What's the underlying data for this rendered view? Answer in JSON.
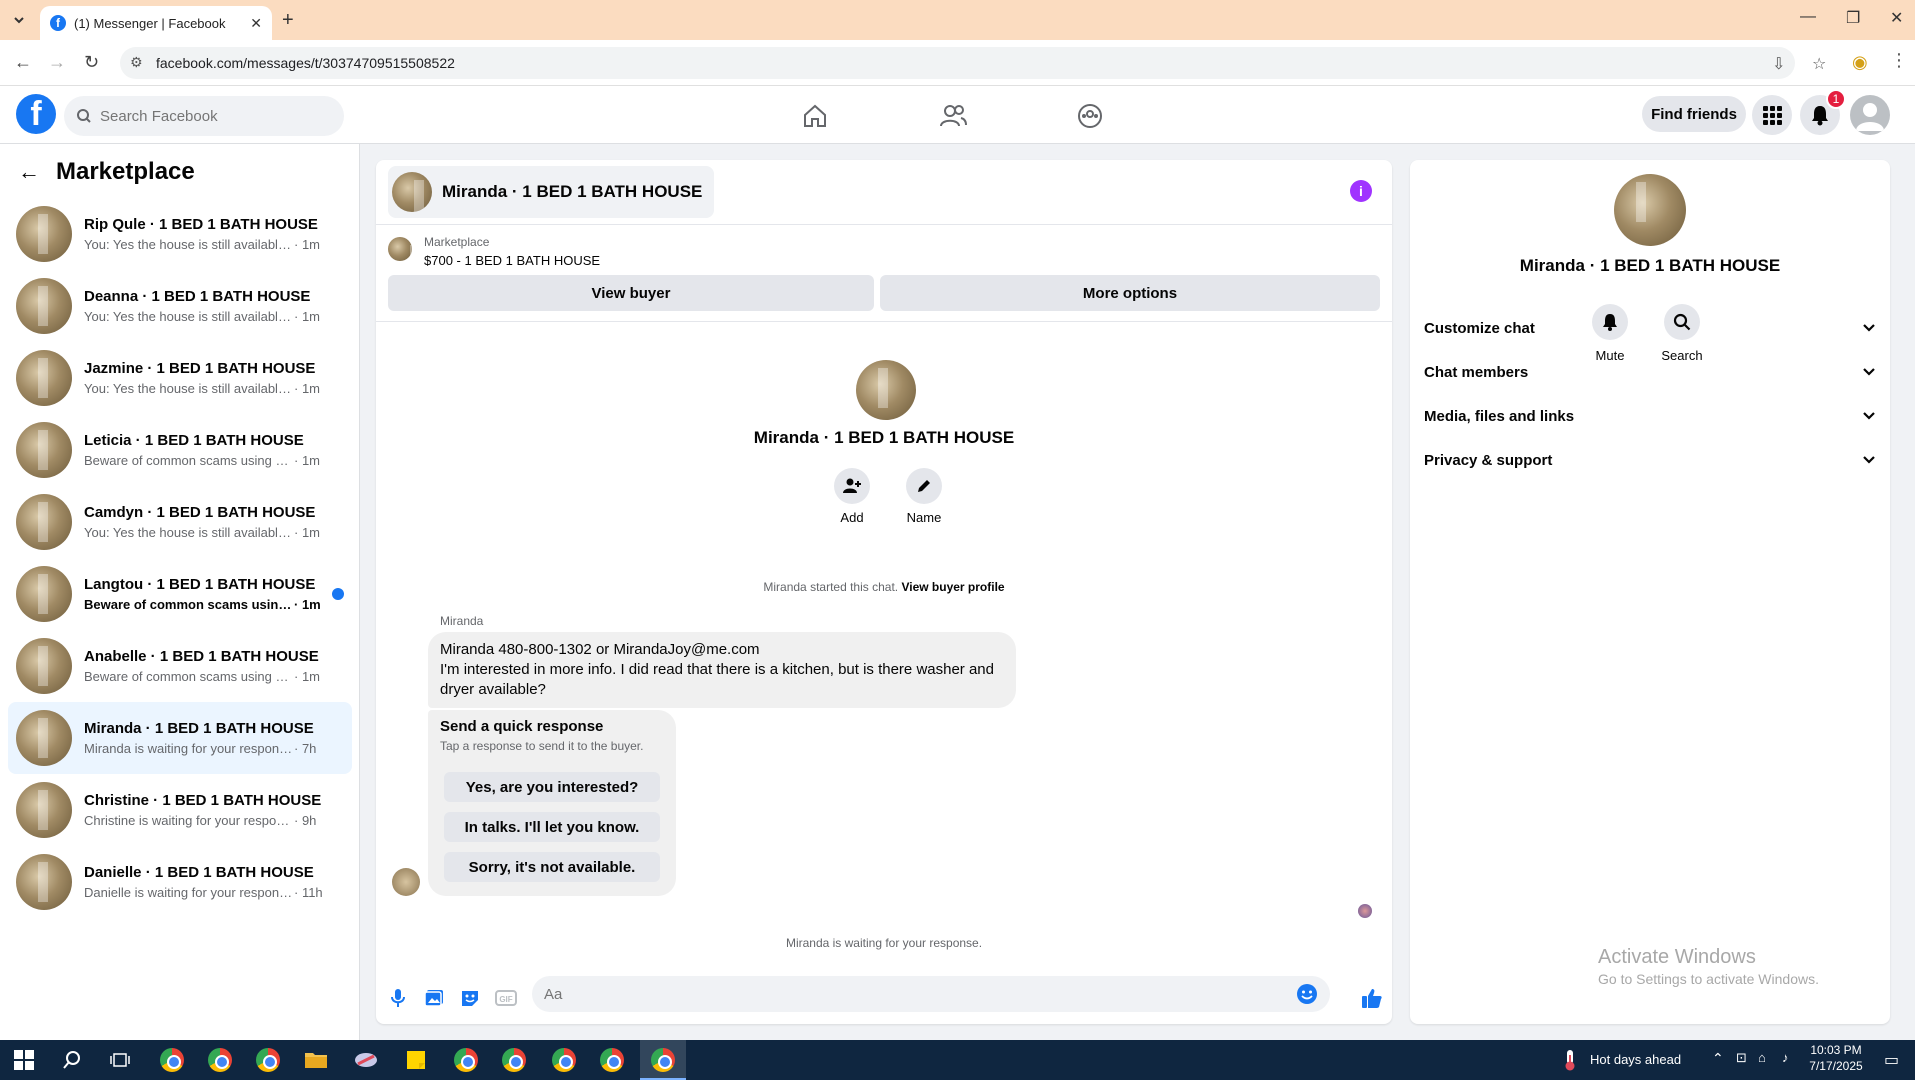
{
  "browser": {
    "tab_title": "(1) Messenger | Facebook",
    "url": "facebook.com/messages/t/30374709515508522"
  },
  "header": {
    "search_placeholder": "Search Facebook",
    "find_friends": "Find friends",
    "notification_count": "1"
  },
  "left_panel": {
    "title": "Marketplace",
    "conversations": [
      {
        "name": "Rip Qule · 1 BED 1 BATH HOUSE",
        "preview": "You: Yes the house is still available for...",
        "time": "· 1m"
      },
      {
        "name": "Deanna · 1 BED 1 BATH HOUSE",
        "preview": "You: Yes the house is still available for...",
        "time": "· 1m"
      },
      {
        "name": "Jazmine · 1 BED 1 BATH HOUSE",
        "preview": "You: Yes the house is still available for...",
        "time": "· 1m"
      },
      {
        "name": "Leticia · 1 BED 1 BATH HOUSE",
        "preview": "Beware of common scams using pay...",
        "time": "· 1m"
      },
      {
        "name": "Camdyn · 1 BED 1 BATH HOUSE",
        "preview": "You: Yes the house is still available for...",
        "time": "· 1m"
      },
      {
        "name": "Langtou · 1 BED 1 BATH HOUSE",
        "preview": "Beware of common scams using p...",
        "time": "· 1m"
      },
      {
        "name": "Anabelle · 1 BED 1 BATH HOUSE",
        "preview": "Beware of common scams using pay...",
        "time": "· 1m"
      },
      {
        "name": "Miranda · 1 BED 1 BATH HOUSE",
        "preview": "Miranda is waiting for your response.",
        "time": "· 7h"
      },
      {
        "name": "Christine · 1 BED 1 BATH HOUSE",
        "preview": "Christine is waiting for your response.",
        "time": "· 9h"
      },
      {
        "name": "Danielle · 1 BED 1 BATH HOUSE",
        "preview": "Danielle is waiting for your response.",
        "time": "· 11h"
      }
    ]
  },
  "chat": {
    "title": "Miranda · 1 BED 1 BATH HOUSE",
    "marketplace_label": "Marketplace",
    "listing": "$700 - 1 BED 1 BATH HOUSE",
    "view_buyer": "View buyer",
    "more_options": "More options",
    "intro_name": "Miranda · 1 BED 1 BATH HOUSE",
    "add_label": "Add",
    "name_label": "Name",
    "started_text": "Miranda started this chat.",
    "view_profile": "View buyer profile",
    "sender": "Miranda",
    "message_line1": "Miranda 480-800-1302 or MirandaJoy@me.com",
    "message_line2": "I'm interested in more info. I did read that there is a kitchen, but is there washer and dryer available?",
    "quick_title": "Send a quick response",
    "quick_sub": "Tap a response to send it to the buyer.",
    "quick_responses": [
      "Yes, are you interested?",
      "In talks. I'll let you know.",
      "Sorry, it's not available."
    ],
    "waiting": "Miranda is waiting for your response.",
    "composer_placeholder": "Aa"
  },
  "right_panel": {
    "name": "Miranda · 1 BED 1 BATH HOUSE",
    "mute": "Mute",
    "search": "Search",
    "sections": [
      "Customize chat",
      "Chat members",
      "Media, files and links",
      "Privacy & support"
    ]
  },
  "watermark": {
    "line1": "Activate Windows",
    "line2": "Go to Settings to activate Windows."
  },
  "taskbar": {
    "weather": "Hot days ahead",
    "time": "10:03 PM",
    "date": "7/17/2025"
  },
  "colors": {
    "brand": "#1877f2",
    "info": "#a033ff",
    "tab_bar": "#fbdcc0"
  }
}
